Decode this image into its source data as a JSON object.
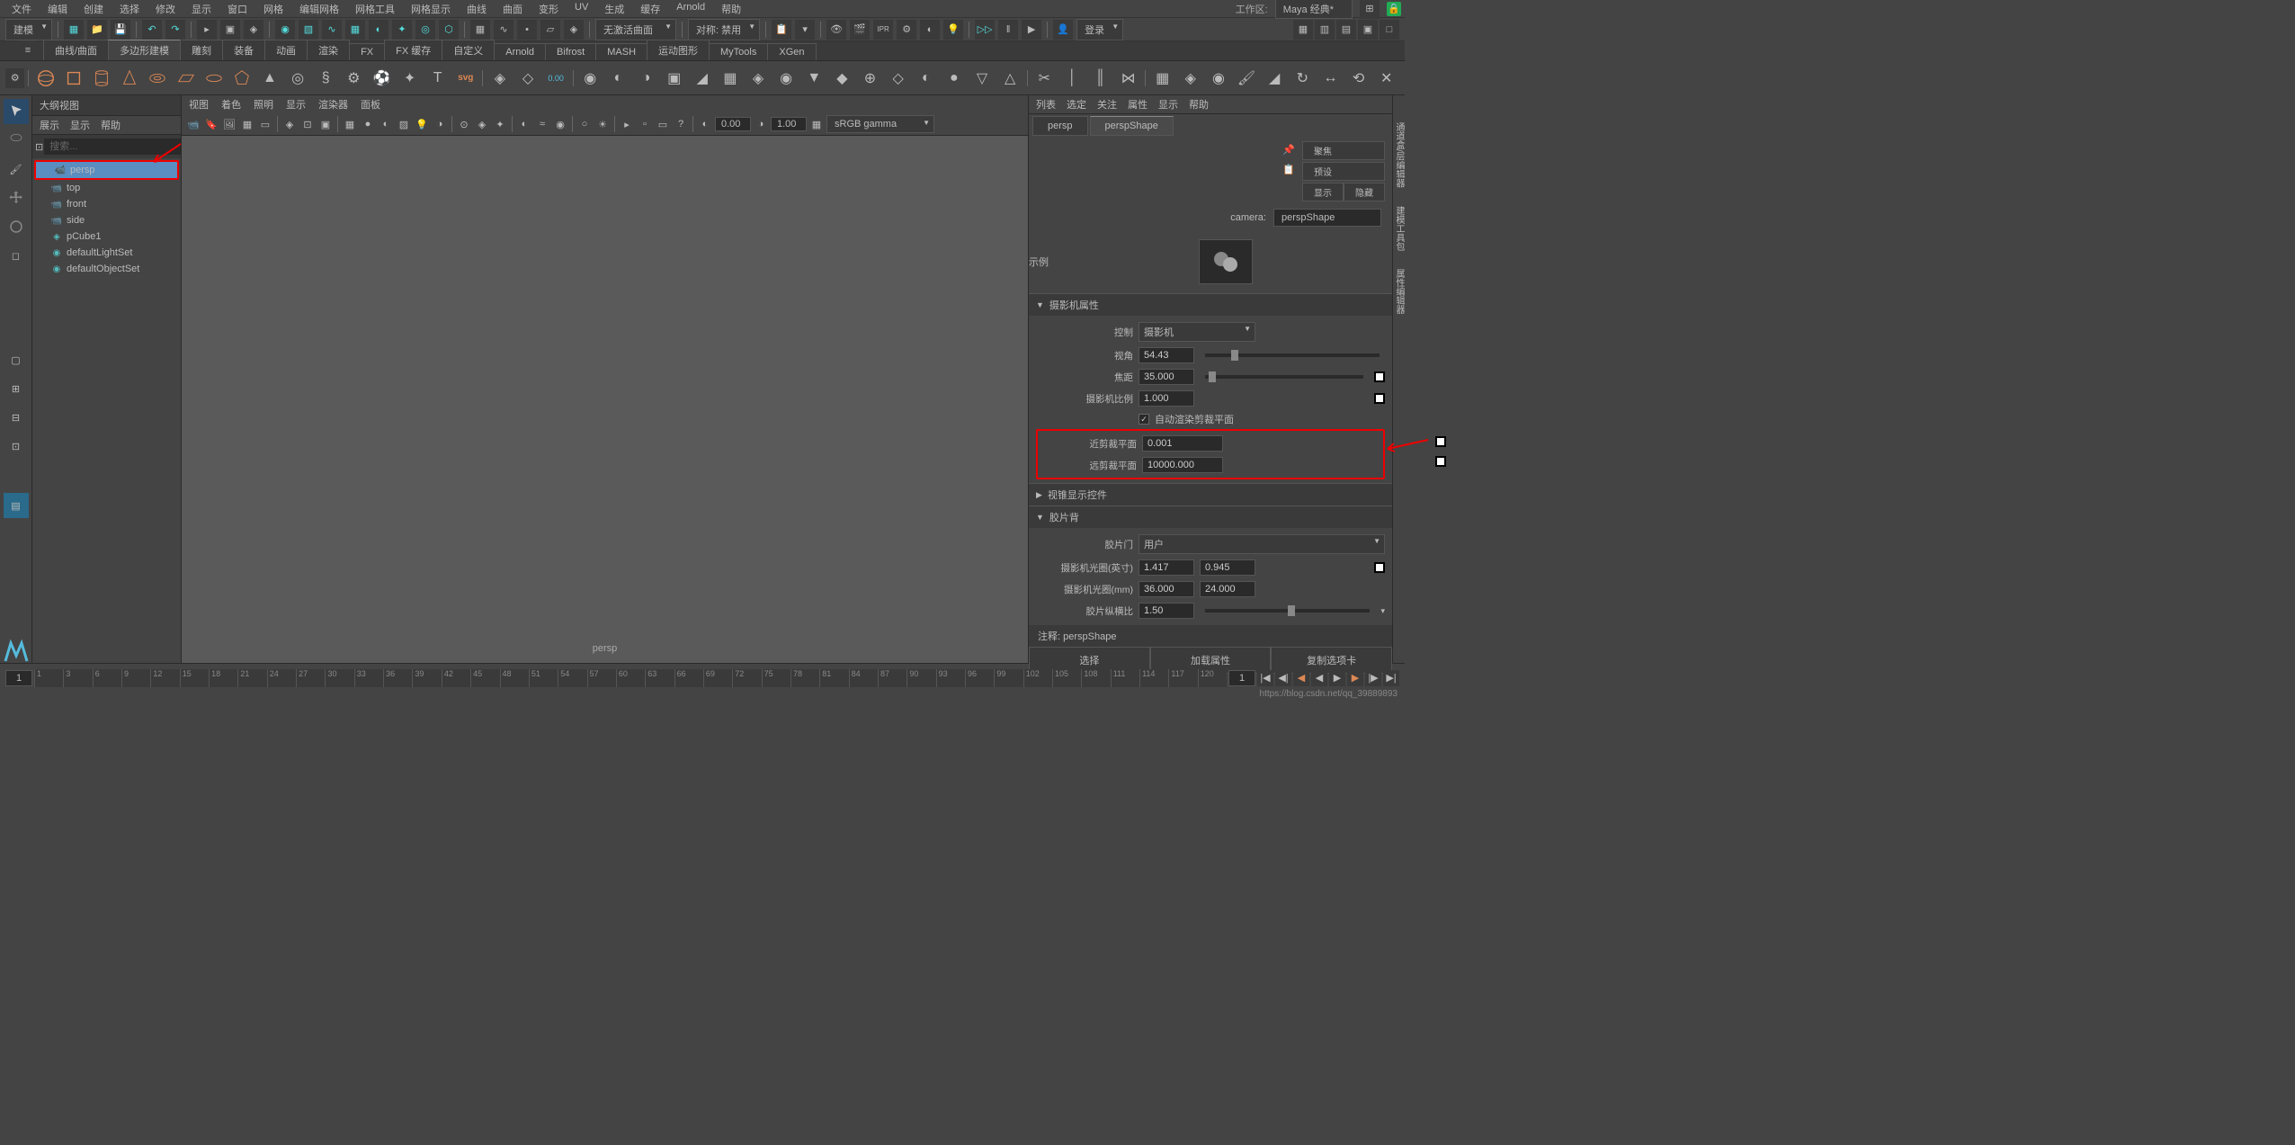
{
  "menubar": {
    "items": [
      "文件",
      "编辑",
      "创建",
      "选择",
      "修改",
      "显示",
      "窗口",
      "网格",
      "编辑网格",
      "网格工具",
      "网格显示",
      "曲线",
      "曲面",
      "变形",
      "UV",
      "生成",
      "缓存",
      "Arnold",
      "帮助"
    ],
    "workspace_label": "工作区:",
    "workspace_value": "Maya 经典*"
  },
  "toolbar1": {
    "mode": "建模",
    "curve_label": "无激活曲面",
    "sym_label": "对称: 禁用",
    "login": "登录"
  },
  "tabs": {
    "items": [
      "曲线/曲面",
      "多边形建模",
      "雕刻",
      "装备",
      "动画",
      "渲染",
      "FX",
      "FX 缓存",
      "自定义",
      "Arnold",
      "Bifrost",
      "MASH",
      "运动图形",
      "MyTools",
      "XGen"
    ],
    "active": 1
  },
  "outliner": {
    "title": "大纲视图",
    "menu": [
      "展示",
      "显示",
      "帮助"
    ],
    "search_placeholder": "搜索...",
    "items": [
      {
        "name": "persp",
        "icon": "cam",
        "selected": true
      },
      {
        "name": "top",
        "icon": "cam"
      },
      {
        "name": "front",
        "icon": "cam"
      },
      {
        "name": "side",
        "icon": "cam"
      },
      {
        "name": "pCube1",
        "icon": "obj"
      },
      {
        "name": "defaultLightSet",
        "icon": "set"
      },
      {
        "name": "defaultObjectSet",
        "icon": "set"
      }
    ]
  },
  "viewport": {
    "menu": [
      "视图",
      "着色",
      "照明",
      "显示",
      "渲染器",
      "面板"
    ],
    "val1": "0.00",
    "val2": "1.00",
    "colorspace": "sRGB gamma",
    "label": "persp"
  },
  "attr": {
    "menu": [
      "列表",
      "选定",
      "关注",
      "属性",
      "显示",
      "帮助"
    ],
    "tabs": [
      "persp",
      "perspShape"
    ],
    "active_tab": 1,
    "btns": {
      "focus": "聚焦",
      "preset": "预设",
      "show": "显示",
      "hide": "隐藏"
    },
    "camera_label": "camera:",
    "camera_name": "perspShape",
    "thumb_label": "示例",
    "sect_camera": "摄影机属性",
    "sect_frustum": "视锥显示控件",
    "sect_film": "胶片背",
    "control_label": "控制",
    "control_val": "摄影机",
    "fov_label": "视角",
    "fov_val": "54.43",
    "focal_label": "焦距",
    "focal_val": "35.000",
    "scale_label": "摄影机比例",
    "scale_val": "1.000",
    "auto_clip_label": "自动渲染剪裁平面",
    "near_label": "近剪裁平面",
    "near_val": "0.001",
    "far_label": "远剪裁平面",
    "far_val": "10000.000",
    "gate_label": "胶片门",
    "gate_val": "用户",
    "aperture_in_label": "摄影机光圈(英寸)",
    "aperture_in_1": "1.417",
    "aperture_in_2": "0.945",
    "aperture_mm_label": "摄影机光圈(mm)",
    "aperture_mm_1": "36.000",
    "aperture_mm_2": "24.000",
    "aspect_label": "胶片纵横比",
    "aspect_val": "1.50",
    "notes_label": "注释:",
    "notes_name": "perspShape",
    "footer": [
      "选择",
      "加载属性",
      "复制选项卡"
    ]
  },
  "timeline": {
    "start": "1",
    "cur": "1",
    "ticks": [
      "1",
      "3",
      "6",
      "9",
      "12",
      "15",
      "18",
      "21",
      "24",
      "27",
      "30",
      "33",
      "36",
      "39",
      "42",
      "45",
      "48",
      "51",
      "54",
      "57",
      "60",
      "63",
      "66",
      "69",
      "72",
      "75",
      "78",
      "81",
      "84",
      "87",
      "90",
      "93",
      "96",
      "99",
      "102",
      "105",
      "108",
      "111",
      "114",
      "117",
      "120"
    ]
  },
  "watermark": "https://blog.csdn.net/qq_39889893"
}
